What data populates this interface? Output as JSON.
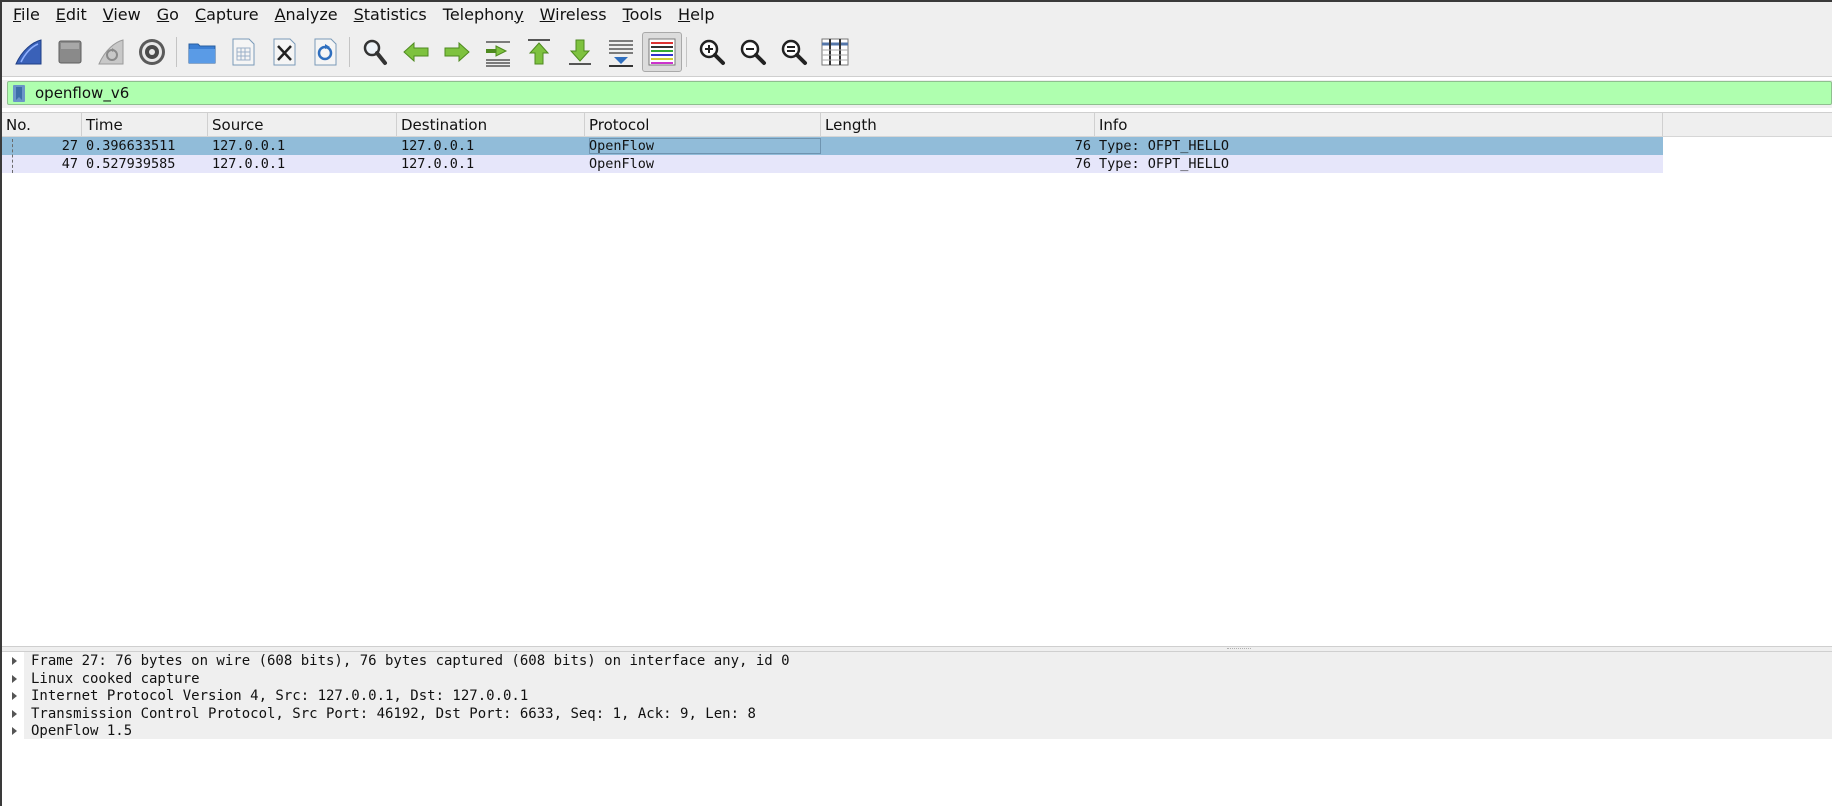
{
  "menu": [
    {
      "mnemonic": "F",
      "rest": "ile"
    },
    {
      "mnemonic": "E",
      "rest": "dit"
    },
    {
      "mnemonic": "V",
      "rest": "iew"
    },
    {
      "mnemonic": "G",
      "rest": "o"
    },
    {
      "mnemonic": "C",
      "rest": "apture"
    },
    {
      "mnemonic": "A",
      "rest": "nalyze"
    },
    {
      "mnemonic": "S",
      "rest": "tatistics"
    },
    {
      "mnemonic": "",
      "rest": "Telephon",
      "tail_mnemonic": "y"
    },
    {
      "mnemonic": "W",
      "rest": "ireless"
    },
    {
      "mnemonic": "T",
      "rest": "ools"
    },
    {
      "mnemonic": "H",
      "rest": "elp"
    }
  ],
  "toolbar_icons": [
    "shark-fin-start-icon",
    "stop-square-icon",
    "restart-fin-icon",
    "capture-options-gear-icon",
    "open-folder-icon",
    "save-file-icon",
    "close-file-icon",
    "reload-file-icon",
    "find-magnifier-icon",
    "go-back-arrow-icon",
    "go-forward-arrow-icon",
    "go-to-packet-icon",
    "first-packet-icon",
    "last-packet-icon",
    "autoscroll-icon",
    "colorize-lines-icon",
    "zoom-in-icon",
    "zoom-out-icon",
    "zoom-normal-icon",
    "resize-columns-icon"
  ],
  "filter": {
    "value": "openflow_v6"
  },
  "columns": [
    "No.",
    "Time",
    "Source",
    "Destination",
    "Protocol",
    "Length",
    "Info"
  ],
  "packets": [
    {
      "no": "27",
      "time": "0.396633511",
      "source": "127.0.0.1",
      "destination": "127.0.0.1",
      "protocol": "OpenFlow",
      "length": "76",
      "info": "Type: OFPT_HELLO",
      "selected": true
    },
    {
      "no": "47",
      "time": "0.527939585",
      "source": "127.0.0.1",
      "destination": "127.0.0.1",
      "protocol": "OpenFlow",
      "length": "76",
      "info": "Type: OFPT_HELLO",
      "selected": false
    }
  ],
  "details": [
    "Frame 27: 76 bytes on wire (608 bits), 76 bytes captured (608 bits) on interface any, id 0",
    "Linux cooked capture",
    "Internet Protocol Version 4, Src: 127.0.0.1, Dst: 127.0.0.1",
    "Transmission Control Protocol, Src Port: 46192, Dst Port: 6633, Seq: 1, Ack: 9, Len: 8",
    "OpenFlow 1.5"
  ],
  "colors": {
    "filter_valid": "#afffaf",
    "selected_row": "#91bcd9",
    "alt_row": "#e6e6fa"
  }
}
